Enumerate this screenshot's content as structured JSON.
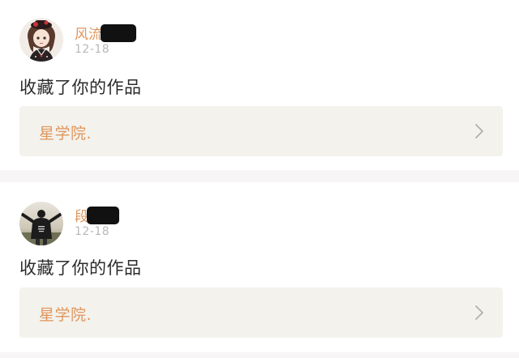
{
  "feed": {
    "items": [
      {
        "username": "风流",
        "date": "12-18",
        "action": "收藏了你的作品",
        "work_title": "星学院.",
        "avatar_icon": "anime-girl-avatar",
        "chevron_icon": "chevron-right-icon"
      },
      {
        "username": "段",
        "date": "12-18",
        "action": "收藏了你的作品",
        "work_title": "星学院.",
        "avatar_icon": "person-hoodie-avatar",
        "chevron_icon": "chevron-right-icon"
      }
    ]
  },
  "colors": {
    "accent": "#e0955c",
    "muted": "#b9b9b9",
    "text": "#2b2b2b",
    "link_bg": "#f3f2ec",
    "page_bg": "#f7f5f6"
  }
}
